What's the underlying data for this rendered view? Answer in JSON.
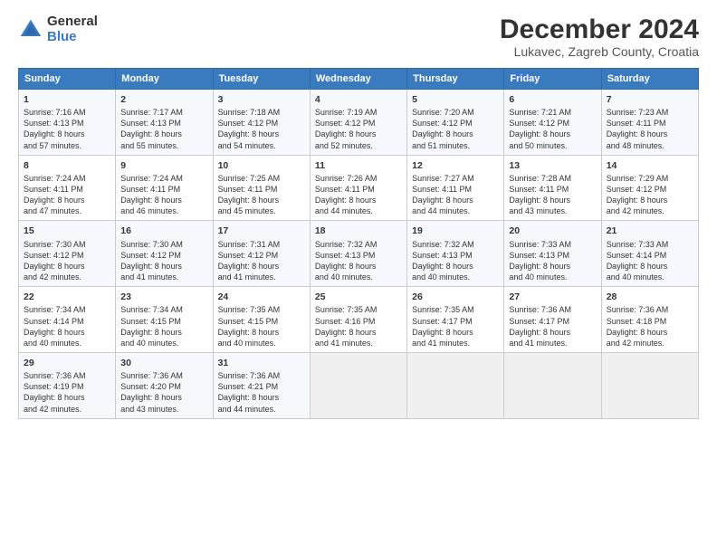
{
  "header": {
    "logo_general": "General",
    "logo_blue": "Blue",
    "title": "December 2024",
    "subtitle": "Lukavec, Zagreb County, Croatia"
  },
  "days_of_week": [
    "Sunday",
    "Monday",
    "Tuesday",
    "Wednesday",
    "Thursday",
    "Friday",
    "Saturday"
  ],
  "weeks": [
    [
      {
        "day": "1",
        "lines": [
          "Sunrise: 7:16 AM",
          "Sunset: 4:13 PM",
          "Daylight: 8 hours",
          "and 57 minutes."
        ]
      },
      {
        "day": "2",
        "lines": [
          "Sunrise: 7:17 AM",
          "Sunset: 4:13 PM",
          "Daylight: 8 hours",
          "and 55 minutes."
        ]
      },
      {
        "day": "3",
        "lines": [
          "Sunrise: 7:18 AM",
          "Sunset: 4:12 PM",
          "Daylight: 8 hours",
          "and 54 minutes."
        ]
      },
      {
        "day": "4",
        "lines": [
          "Sunrise: 7:19 AM",
          "Sunset: 4:12 PM",
          "Daylight: 8 hours",
          "and 52 minutes."
        ]
      },
      {
        "day": "5",
        "lines": [
          "Sunrise: 7:20 AM",
          "Sunset: 4:12 PM",
          "Daylight: 8 hours",
          "and 51 minutes."
        ]
      },
      {
        "day": "6",
        "lines": [
          "Sunrise: 7:21 AM",
          "Sunset: 4:12 PM",
          "Daylight: 8 hours",
          "and 50 minutes."
        ]
      },
      {
        "day": "7",
        "lines": [
          "Sunrise: 7:23 AM",
          "Sunset: 4:11 PM",
          "Daylight: 8 hours",
          "and 48 minutes."
        ]
      }
    ],
    [
      {
        "day": "8",
        "lines": [
          "Sunrise: 7:24 AM",
          "Sunset: 4:11 PM",
          "Daylight: 8 hours",
          "and 47 minutes."
        ]
      },
      {
        "day": "9",
        "lines": [
          "Sunrise: 7:24 AM",
          "Sunset: 4:11 PM",
          "Daylight: 8 hours",
          "and 46 minutes."
        ]
      },
      {
        "day": "10",
        "lines": [
          "Sunrise: 7:25 AM",
          "Sunset: 4:11 PM",
          "Daylight: 8 hours",
          "and 45 minutes."
        ]
      },
      {
        "day": "11",
        "lines": [
          "Sunrise: 7:26 AM",
          "Sunset: 4:11 PM",
          "Daylight: 8 hours",
          "and 44 minutes."
        ]
      },
      {
        "day": "12",
        "lines": [
          "Sunrise: 7:27 AM",
          "Sunset: 4:11 PM",
          "Daylight: 8 hours",
          "and 44 minutes."
        ]
      },
      {
        "day": "13",
        "lines": [
          "Sunrise: 7:28 AM",
          "Sunset: 4:11 PM",
          "Daylight: 8 hours",
          "and 43 minutes."
        ]
      },
      {
        "day": "14",
        "lines": [
          "Sunrise: 7:29 AM",
          "Sunset: 4:12 PM",
          "Daylight: 8 hours",
          "and 42 minutes."
        ]
      }
    ],
    [
      {
        "day": "15",
        "lines": [
          "Sunrise: 7:30 AM",
          "Sunset: 4:12 PM",
          "Daylight: 8 hours",
          "and 42 minutes."
        ]
      },
      {
        "day": "16",
        "lines": [
          "Sunrise: 7:30 AM",
          "Sunset: 4:12 PM",
          "Daylight: 8 hours",
          "and 41 minutes."
        ]
      },
      {
        "day": "17",
        "lines": [
          "Sunrise: 7:31 AM",
          "Sunset: 4:12 PM",
          "Daylight: 8 hours",
          "and 41 minutes."
        ]
      },
      {
        "day": "18",
        "lines": [
          "Sunrise: 7:32 AM",
          "Sunset: 4:13 PM",
          "Daylight: 8 hours",
          "and 40 minutes."
        ]
      },
      {
        "day": "19",
        "lines": [
          "Sunrise: 7:32 AM",
          "Sunset: 4:13 PM",
          "Daylight: 8 hours",
          "and 40 minutes."
        ]
      },
      {
        "day": "20",
        "lines": [
          "Sunrise: 7:33 AM",
          "Sunset: 4:13 PM",
          "Daylight: 8 hours",
          "and 40 minutes."
        ]
      },
      {
        "day": "21",
        "lines": [
          "Sunrise: 7:33 AM",
          "Sunset: 4:14 PM",
          "Daylight: 8 hours",
          "and 40 minutes."
        ]
      }
    ],
    [
      {
        "day": "22",
        "lines": [
          "Sunrise: 7:34 AM",
          "Sunset: 4:14 PM",
          "Daylight: 8 hours",
          "and 40 minutes."
        ]
      },
      {
        "day": "23",
        "lines": [
          "Sunrise: 7:34 AM",
          "Sunset: 4:15 PM",
          "Daylight: 8 hours",
          "and 40 minutes."
        ]
      },
      {
        "day": "24",
        "lines": [
          "Sunrise: 7:35 AM",
          "Sunset: 4:15 PM",
          "Daylight: 8 hours",
          "and 40 minutes."
        ]
      },
      {
        "day": "25",
        "lines": [
          "Sunrise: 7:35 AM",
          "Sunset: 4:16 PM",
          "Daylight: 8 hours",
          "and 41 minutes."
        ]
      },
      {
        "day": "26",
        "lines": [
          "Sunrise: 7:35 AM",
          "Sunset: 4:17 PM",
          "Daylight: 8 hours",
          "and 41 minutes."
        ]
      },
      {
        "day": "27",
        "lines": [
          "Sunrise: 7:36 AM",
          "Sunset: 4:17 PM",
          "Daylight: 8 hours",
          "and 41 minutes."
        ]
      },
      {
        "day": "28",
        "lines": [
          "Sunrise: 7:36 AM",
          "Sunset: 4:18 PM",
          "Daylight: 8 hours",
          "and 42 minutes."
        ]
      }
    ],
    [
      {
        "day": "29",
        "lines": [
          "Sunrise: 7:36 AM",
          "Sunset: 4:19 PM",
          "Daylight: 8 hours",
          "and 42 minutes."
        ]
      },
      {
        "day": "30",
        "lines": [
          "Sunrise: 7:36 AM",
          "Sunset: 4:20 PM",
          "Daylight: 8 hours",
          "and 43 minutes."
        ]
      },
      {
        "day": "31",
        "lines": [
          "Sunrise: 7:36 AM",
          "Sunset: 4:21 PM",
          "Daylight: 8 hours",
          "and 44 minutes."
        ]
      },
      null,
      null,
      null,
      null
    ]
  ]
}
